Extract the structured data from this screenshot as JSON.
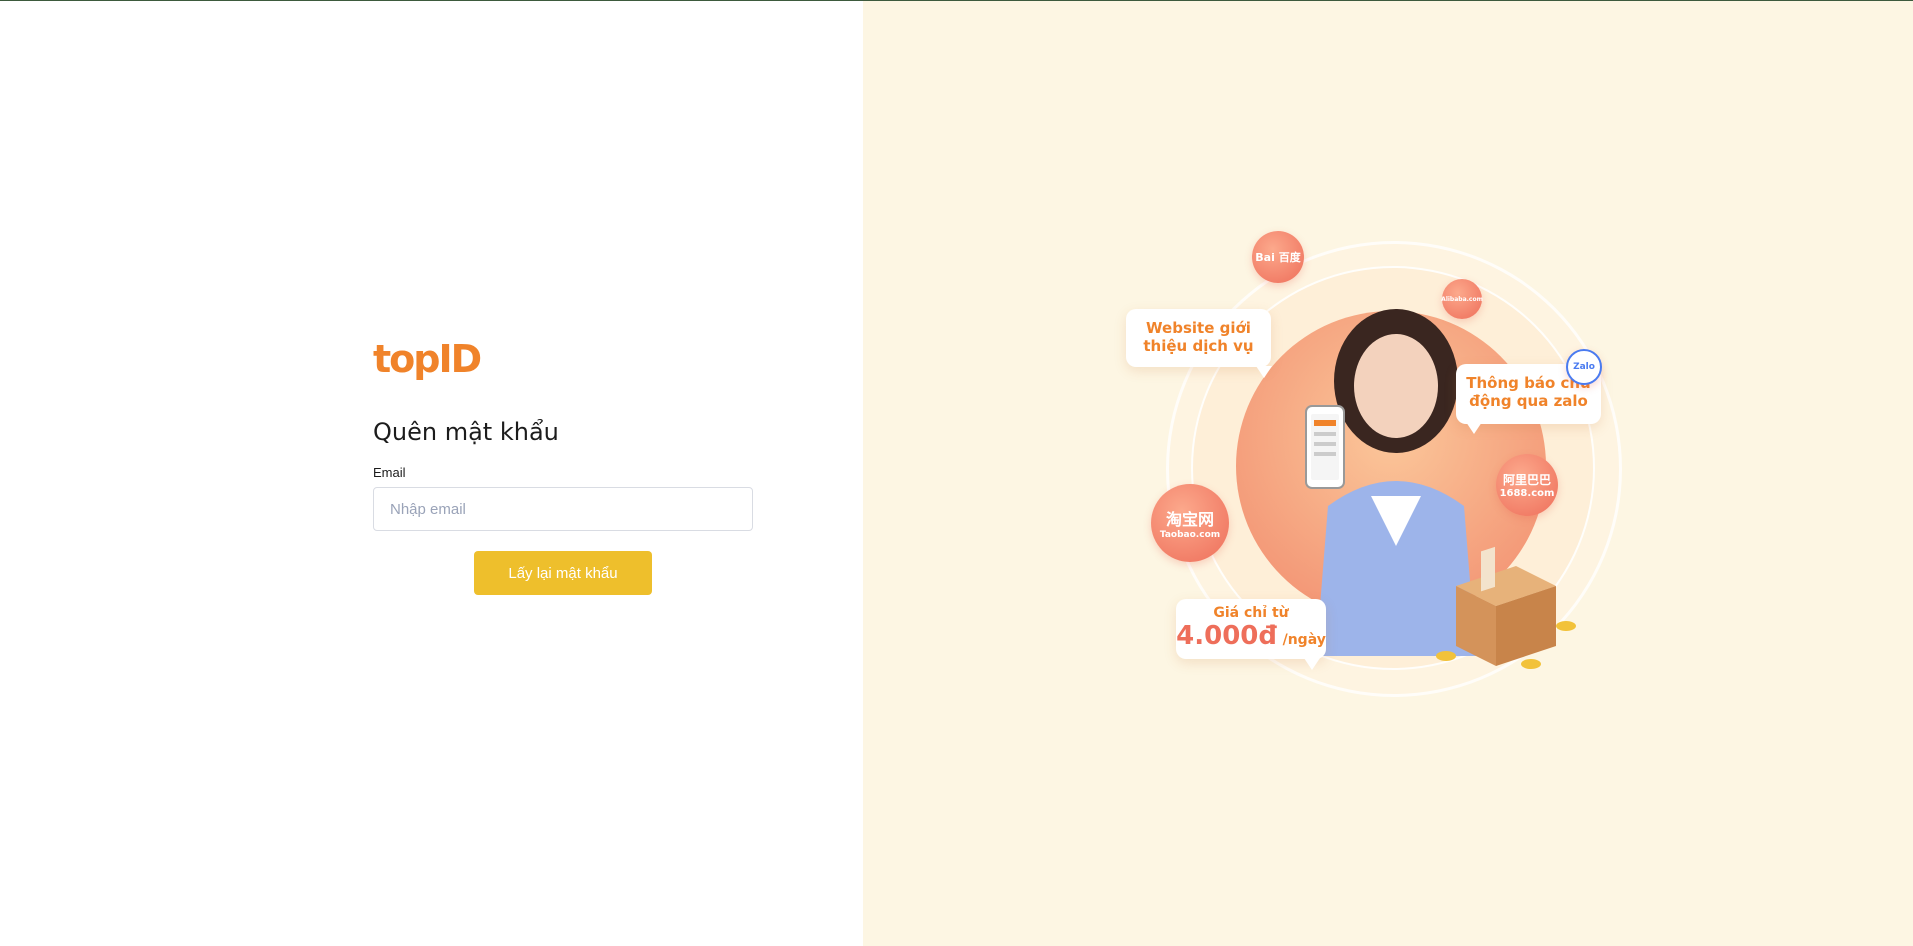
{
  "brand": {
    "logo_text": "topID"
  },
  "form": {
    "title": "Quên mật khẩu",
    "email_label": "Email",
    "email_placeholder": "Nhập email",
    "email_value": "",
    "submit_label": "Lấy lại mật khẩu"
  },
  "promo": {
    "bubble_website": "Website giới thiệu dịch vụ",
    "bubble_zalo": "Thông báo chủ động qua zalo",
    "price_prefix": "Giá chỉ từ",
    "price_value": "4.000đ",
    "price_unit": "/ngày",
    "badge_baidu": "Bai 百度",
    "badge_alibaba": "Alibaba.com",
    "badge_taobao_cn": "淘宝网",
    "badge_taobao_en": "Taobao.com",
    "badge_1688_cn": "阿里巴巴",
    "badge_1688_en": "1688.com",
    "badge_zalo": "Zalo"
  },
  "colors": {
    "brand_orange": "#f0832a",
    "button_yellow": "#eebf2c",
    "right_pane_bg": "#fdf6e3"
  }
}
